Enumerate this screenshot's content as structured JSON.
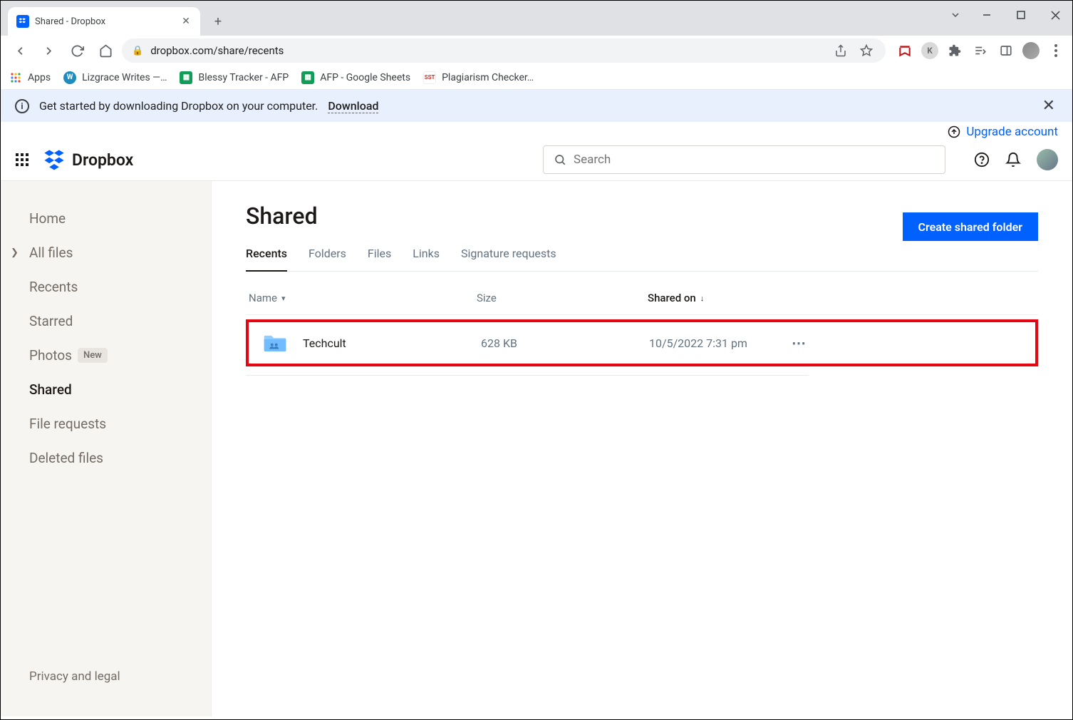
{
  "browser": {
    "tab_title": "Shared - Dropbox",
    "url": "dropbox.com/share/recents",
    "bookmarks": [
      {
        "label": "Apps",
        "color": "#fff",
        "bg": "#fff",
        "border": "grid"
      },
      {
        "label": "Lizgrace Writes —…",
        "bg": "#1e8cbe"
      },
      {
        "label": "Blessy Tracker - AFP",
        "bg": "#0f9d58"
      },
      {
        "label": "AFP - Google Sheets",
        "bg": "#0f9d58"
      },
      {
        "label": "Plagiarism Checker…",
        "bg": "#fff",
        "txt": "SST",
        "txtcolor": "#d93025"
      }
    ]
  },
  "banner": {
    "text": "Get started by downloading Dropbox on your computer.",
    "link": "Download"
  },
  "header": {
    "upgrade": "Upgrade account",
    "brand": "Dropbox",
    "search_placeholder": "Search"
  },
  "sidebar": {
    "items": [
      {
        "label": "Home"
      },
      {
        "label": "All files",
        "expand": true
      },
      {
        "label": "Recents"
      },
      {
        "label": "Starred"
      },
      {
        "label": "Photos",
        "badge": "New"
      },
      {
        "label": "Shared",
        "active": true
      },
      {
        "label": "File requests"
      },
      {
        "label": "Deleted files"
      }
    ],
    "footer": "Privacy and legal"
  },
  "page": {
    "title": "Shared",
    "cta": "Create shared folder",
    "tabs": [
      {
        "label": "Recents",
        "active": true
      },
      {
        "label": "Folders"
      },
      {
        "label": "Files"
      },
      {
        "label": "Links"
      },
      {
        "label": "Signature requests"
      }
    ],
    "columns": {
      "name": "Name",
      "size": "Size",
      "shared": "Shared on"
    },
    "rows": [
      {
        "name": "Techcult",
        "size": "628 KB",
        "shared": "10/5/2022 7:31 pm"
      }
    ]
  }
}
